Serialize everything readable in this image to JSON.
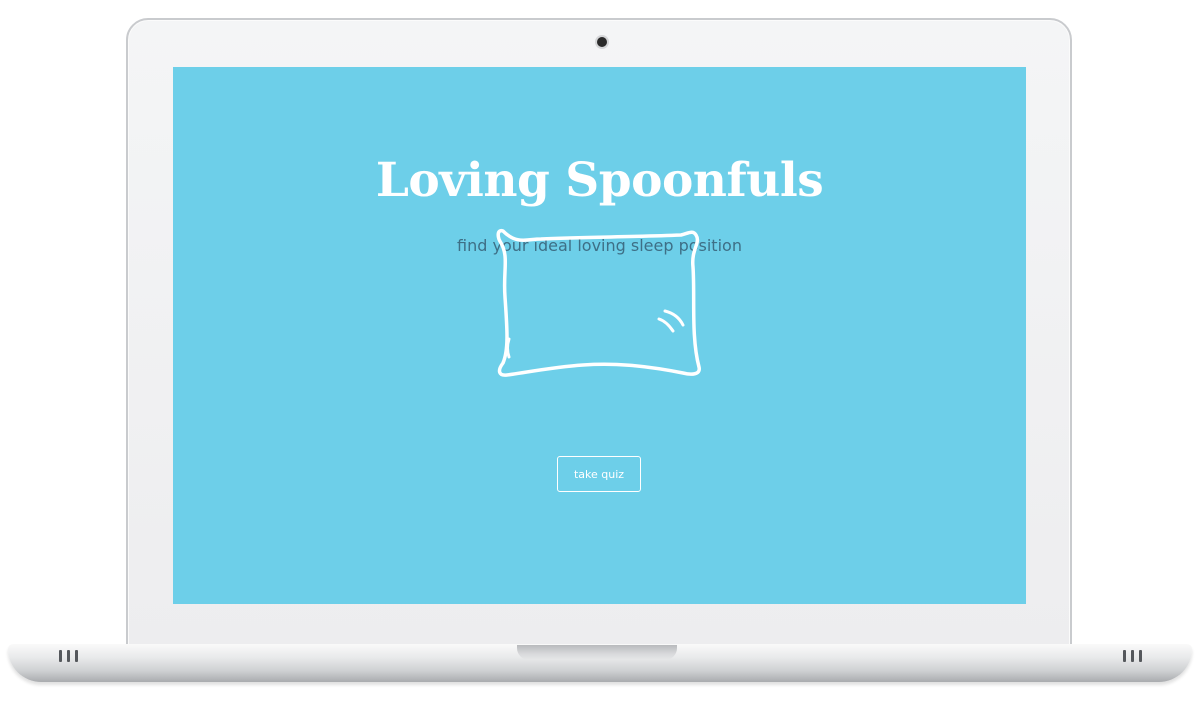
{
  "app": {
    "title": "Loving Spoonfuls",
    "tagline": "find your ideal loving sleep position",
    "illustration": "pillow-icon",
    "cta_label": "take quiz"
  },
  "colors": {
    "screen_background": "#6dcfe9",
    "title": "#ffffff",
    "tagline": "#3e6f86",
    "button_border": "#ffffff"
  }
}
